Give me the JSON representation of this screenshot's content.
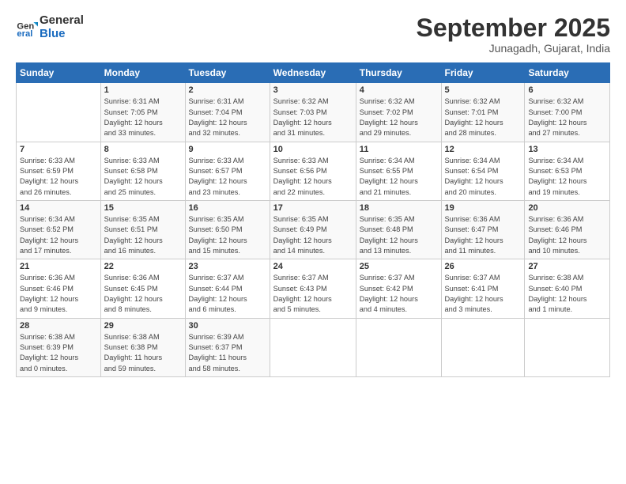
{
  "header": {
    "logo_line1": "General",
    "logo_line2": "Blue",
    "month": "September 2025",
    "location": "Junagadh, Gujarat, India"
  },
  "days_of_week": [
    "Sunday",
    "Monday",
    "Tuesday",
    "Wednesday",
    "Thursday",
    "Friday",
    "Saturday"
  ],
  "weeks": [
    [
      {
        "day": "",
        "info": ""
      },
      {
        "day": "1",
        "info": "Sunrise: 6:31 AM\nSunset: 7:05 PM\nDaylight: 12 hours\nand 33 minutes."
      },
      {
        "day": "2",
        "info": "Sunrise: 6:31 AM\nSunset: 7:04 PM\nDaylight: 12 hours\nand 32 minutes."
      },
      {
        "day": "3",
        "info": "Sunrise: 6:32 AM\nSunset: 7:03 PM\nDaylight: 12 hours\nand 31 minutes."
      },
      {
        "day": "4",
        "info": "Sunrise: 6:32 AM\nSunset: 7:02 PM\nDaylight: 12 hours\nand 29 minutes."
      },
      {
        "day": "5",
        "info": "Sunrise: 6:32 AM\nSunset: 7:01 PM\nDaylight: 12 hours\nand 28 minutes."
      },
      {
        "day": "6",
        "info": "Sunrise: 6:32 AM\nSunset: 7:00 PM\nDaylight: 12 hours\nand 27 minutes."
      }
    ],
    [
      {
        "day": "7",
        "info": "Sunrise: 6:33 AM\nSunset: 6:59 PM\nDaylight: 12 hours\nand 26 minutes."
      },
      {
        "day": "8",
        "info": "Sunrise: 6:33 AM\nSunset: 6:58 PM\nDaylight: 12 hours\nand 25 minutes."
      },
      {
        "day": "9",
        "info": "Sunrise: 6:33 AM\nSunset: 6:57 PM\nDaylight: 12 hours\nand 23 minutes."
      },
      {
        "day": "10",
        "info": "Sunrise: 6:33 AM\nSunset: 6:56 PM\nDaylight: 12 hours\nand 22 minutes."
      },
      {
        "day": "11",
        "info": "Sunrise: 6:34 AM\nSunset: 6:55 PM\nDaylight: 12 hours\nand 21 minutes."
      },
      {
        "day": "12",
        "info": "Sunrise: 6:34 AM\nSunset: 6:54 PM\nDaylight: 12 hours\nand 20 minutes."
      },
      {
        "day": "13",
        "info": "Sunrise: 6:34 AM\nSunset: 6:53 PM\nDaylight: 12 hours\nand 19 minutes."
      }
    ],
    [
      {
        "day": "14",
        "info": "Sunrise: 6:34 AM\nSunset: 6:52 PM\nDaylight: 12 hours\nand 17 minutes."
      },
      {
        "day": "15",
        "info": "Sunrise: 6:35 AM\nSunset: 6:51 PM\nDaylight: 12 hours\nand 16 minutes."
      },
      {
        "day": "16",
        "info": "Sunrise: 6:35 AM\nSunset: 6:50 PM\nDaylight: 12 hours\nand 15 minutes."
      },
      {
        "day": "17",
        "info": "Sunrise: 6:35 AM\nSunset: 6:49 PM\nDaylight: 12 hours\nand 14 minutes."
      },
      {
        "day": "18",
        "info": "Sunrise: 6:35 AM\nSunset: 6:48 PM\nDaylight: 12 hours\nand 13 minutes."
      },
      {
        "day": "19",
        "info": "Sunrise: 6:36 AM\nSunset: 6:47 PM\nDaylight: 12 hours\nand 11 minutes."
      },
      {
        "day": "20",
        "info": "Sunrise: 6:36 AM\nSunset: 6:46 PM\nDaylight: 12 hours\nand 10 minutes."
      }
    ],
    [
      {
        "day": "21",
        "info": "Sunrise: 6:36 AM\nSunset: 6:46 PM\nDaylight: 12 hours\nand 9 minutes."
      },
      {
        "day": "22",
        "info": "Sunrise: 6:36 AM\nSunset: 6:45 PM\nDaylight: 12 hours\nand 8 minutes."
      },
      {
        "day": "23",
        "info": "Sunrise: 6:37 AM\nSunset: 6:44 PM\nDaylight: 12 hours\nand 6 minutes."
      },
      {
        "day": "24",
        "info": "Sunrise: 6:37 AM\nSunset: 6:43 PM\nDaylight: 12 hours\nand 5 minutes."
      },
      {
        "day": "25",
        "info": "Sunrise: 6:37 AM\nSunset: 6:42 PM\nDaylight: 12 hours\nand 4 minutes."
      },
      {
        "day": "26",
        "info": "Sunrise: 6:37 AM\nSunset: 6:41 PM\nDaylight: 12 hours\nand 3 minutes."
      },
      {
        "day": "27",
        "info": "Sunrise: 6:38 AM\nSunset: 6:40 PM\nDaylight: 12 hours\nand 1 minute."
      }
    ],
    [
      {
        "day": "28",
        "info": "Sunrise: 6:38 AM\nSunset: 6:39 PM\nDaylight: 12 hours\nand 0 minutes."
      },
      {
        "day": "29",
        "info": "Sunrise: 6:38 AM\nSunset: 6:38 PM\nDaylight: 11 hours\nand 59 minutes."
      },
      {
        "day": "30",
        "info": "Sunrise: 6:39 AM\nSunset: 6:37 PM\nDaylight: 11 hours\nand 58 minutes."
      },
      {
        "day": "",
        "info": ""
      },
      {
        "day": "",
        "info": ""
      },
      {
        "day": "",
        "info": ""
      },
      {
        "day": "",
        "info": ""
      }
    ]
  ]
}
